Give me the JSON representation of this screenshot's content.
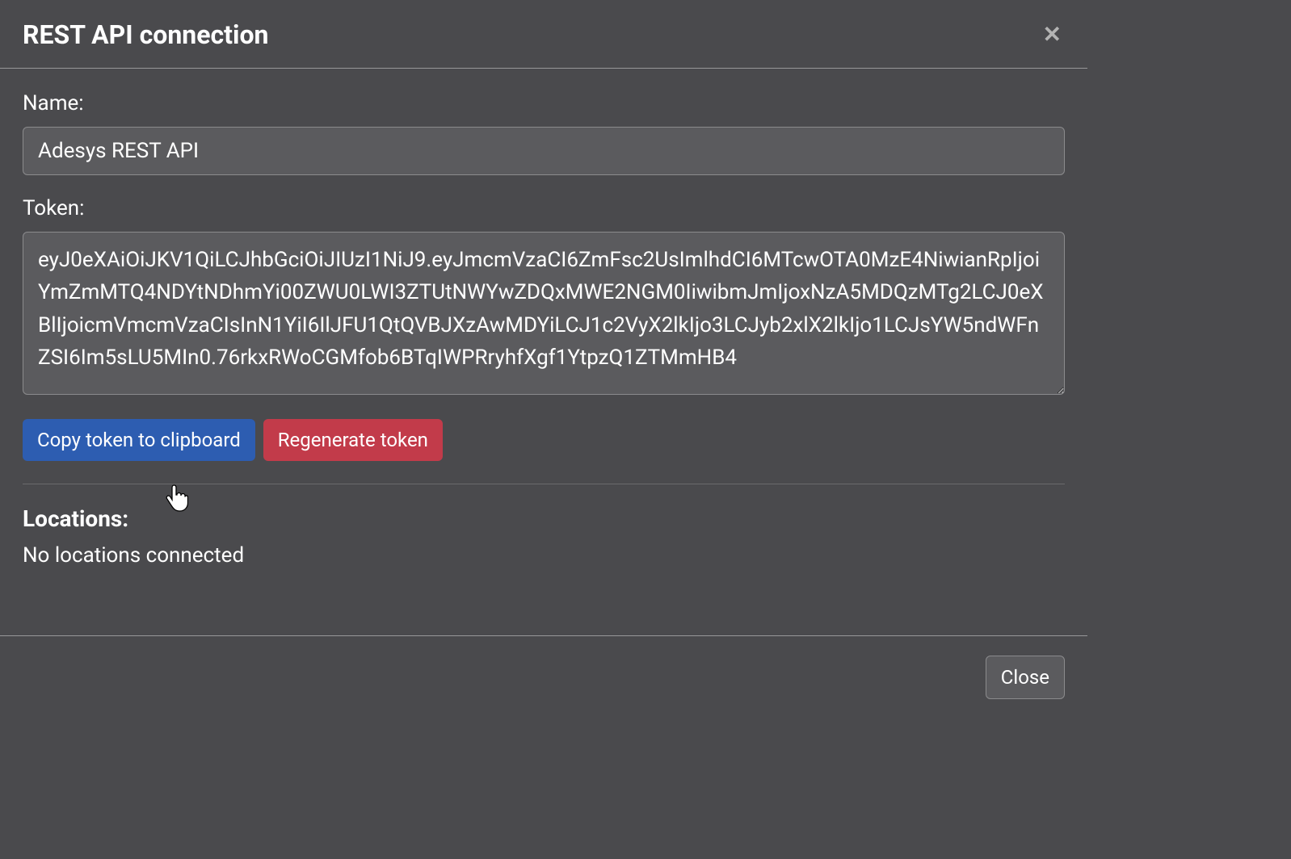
{
  "dialog": {
    "title": "REST API connection",
    "name_label": "Name:",
    "name_value": "Adesys REST API",
    "token_label": "Token:",
    "token_value": "eyJ0eXAiOiJKV1QiLCJhbGciOiJIUzI1NiJ9.eyJmcmVzaCI6ZmFsc2UsImlhdCI6MTcwOTA0MzE4NiwianRpIjoiYmZmMTQ4NDYtNDhmYi00ZWU0LWI3ZTUtNWYwZDQxMWE2NGM0IiwibmJmIjoxNzA5MDQzMTg2LCJ0eXBlIjoicmVmcmVzaCIsInN1YiI6IlJFU1QtQVBJXzAwMDYiLCJ1c2VyX2lkIjo3LCJyb2xlX2lkIjo1LCJsYW5ndWFnZSI6Im5sLU5MIn0.76rkxRWoCGMfob6BTqIWPRryhfXgf1YtpzQ1ZTMmHB4",
    "copy_button_label": "Copy token to clipboard",
    "regen_button_label": "Regenerate token",
    "locations_heading": "Locations:",
    "locations_text": "No locations connected",
    "close_button_label": "Close"
  }
}
